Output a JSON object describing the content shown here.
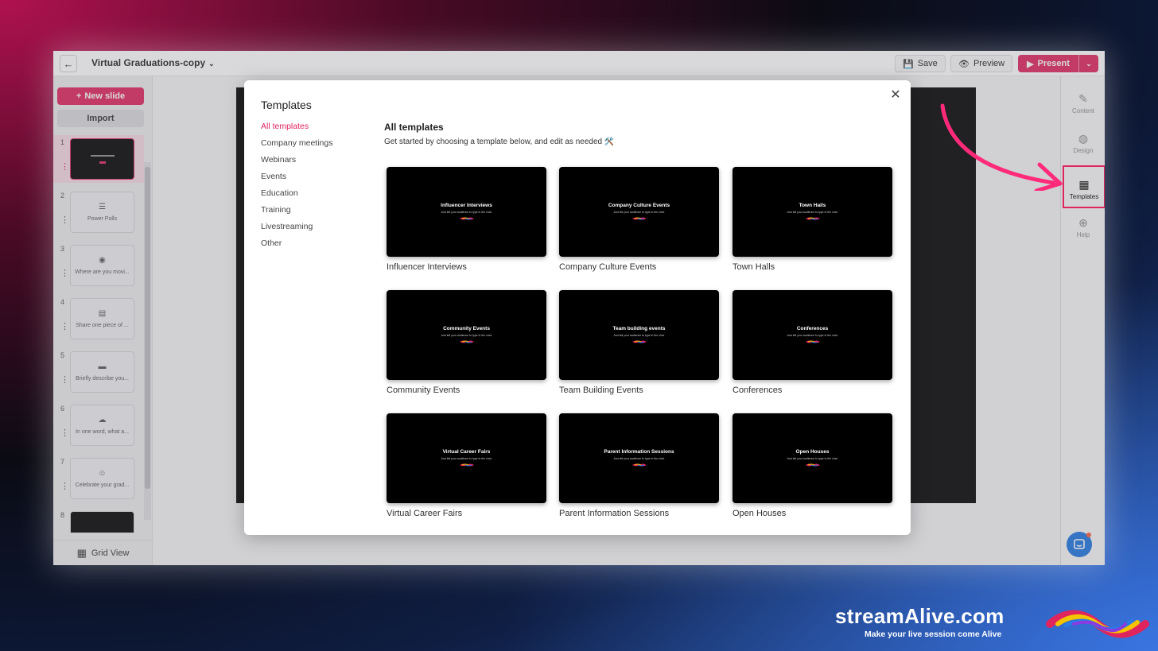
{
  "app": {
    "doc_title": "Virtual Graduations-copy",
    "save_label": "Save",
    "preview_label": "Preview",
    "present_label": "Present"
  },
  "left_panel": {
    "new_slide_label": "New slide",
    "import_label": "Import",
    "grid_view_label": "Grid View",
    "slides": [
      {
        "num": "1",
        "label": "",
        "icon": "title-slide"
      },
      {
        "num": "2",
        "label": "Power Polls",
        "icon": "poll-icon"
      },
      {
        "num": "3",
        "label": "Where are you movi...",
        "icon": "map-pin-icon"
      },
      {
        "num": "4",
        "label": "Share one piece of ...",
        "icon": "chat-icon"
      },
      {
        "num": "5",
        "label": "Briefly describe you...",
        "icon": "text-icon"
      },
      {
        "num": "6",
        "label": "In one word, what a...",
        "icon": "cloud-icon"
      },
      {
        "num": "7",
        "label": "Celebrate your grad...",
        "icon": "emoji-icon"
      },
      {
        "num": "8",
        "label": "",
        "icon": "title-slide"
      }
    ]
  },
  "right_panel": {
    "content_label": "Content",
    "design_label": "Design",
    "templates_label": "Templates",
    "help_label": "Help"
  },
  "modal": {
    "title": "Templates",
    "categories": [
      "All templates",
      "Company meetings",
      "Webinars",
      "Events",
      "Education",
      "Training",
      "Livestreaming",
      "Other"
    ],
    "section_title": "All templates",
    "section_subtitle": "Get started by choosing a template below, and edit as needed 🛠️",
    "templates": [
      {
        "thumb_title": "Influencer Interviews",
        "name": "Influencer Interviews"
      },
      {
        "thumb_title": "Company Culture Events",
        "name": "Company Culture Events"
      },
      {
        "thumb_title": "Town Halls",
        "name": "Town Halls"
      },
      {
        "thumb_title": "Community Events",
        "name": "Community Events"
      },
      {
        "thumb_title": "Team building events",
        "name": "Team Building Events"
      },
      {
        "thumb_title": "Conferences",
        "name": "Conferences"
      },
      {
        "thumb_title": "Virtual Career Fairs",
        "name": "Virtual Career Fairs"
      },
      {
        "thumb_title": "Parent Information Sessions",
        "name": "Parent Information Sessions"
      },
      {
        "thumb_title": "Open Houses",
        "name": "Open Houses"
      }
    ],
    "thumb_subtitle": "Just tell your audience to type in the chat."
  },
  "brand": {
    "name": "streamAlive.com",
    "tagline": "Make your live session come Alive"
  },
  "colors": {
    "accent": "#e0245e",
    "chat": "#1e73e0"
  }
}
